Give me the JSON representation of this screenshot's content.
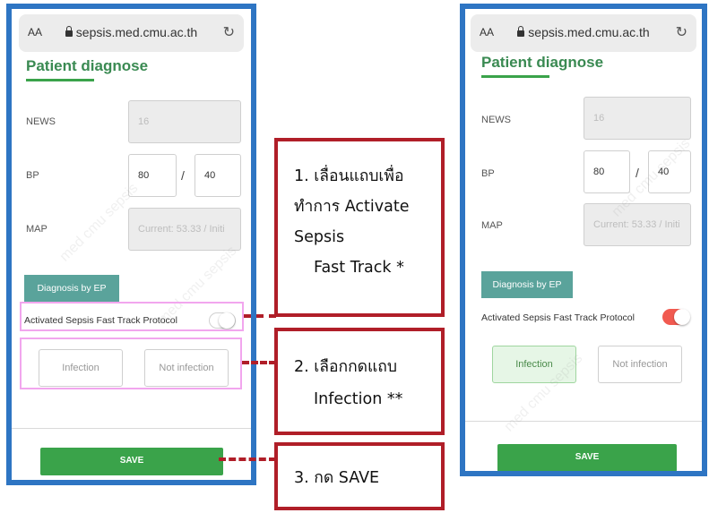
{
  "browser": {
    "font_size_label": "AA",
    "url": "sepsis.med.cmu.ac.th",
    "reload_icon": "↻"
  },
  "screen": {
    "title": "Patient diagnose",
    "news_label": "NEWS",
    "news_value": "16",
    "bp_label": "BP",
    "bp_systolic": "80",
    "bp_separator": "/",
    "bp_diastolic": "40",
    "map_label": "MAP",
    "map_value": "Current: 53.33 / Initi",
    "diagnosis_button": "Diagnosis by EP",
    "fast_track_label": "Activated Sepsis Fast Track Protocol",
    "infection_button": "Infection",
    "not_infection_button": "Not infection",
    "save_button": "SAVE"
  },
  "before": {
    "fast_track_on": false,
    "infection_selected": false
  },
  "after": {
    "fast_track_on": true,
    "infection_selected": true
  },
  "callouts": {
    "step1": {
      "line1": "1. เลื่อนแถบเพื่อ",
      "line2": "ทำการ Activate",
      "line3": "Sepsis",
      "line4": "Fast Track *"
    },
    "step2": {
      "line1": "2. เลือกกดแถบ",
      "line2": "Infection **"
    },
    "step3": {
      "line1": "3. กด SAVE"
    }
  },
  "colors": {
    "phone_frame": "#2e75c3",
    "callout_border": "#b01e28",
    "highlight": "#f2a6ee",
    "accent_green": "#3aa34a",
    "toggle_on": "#f15a50"
  }
}
